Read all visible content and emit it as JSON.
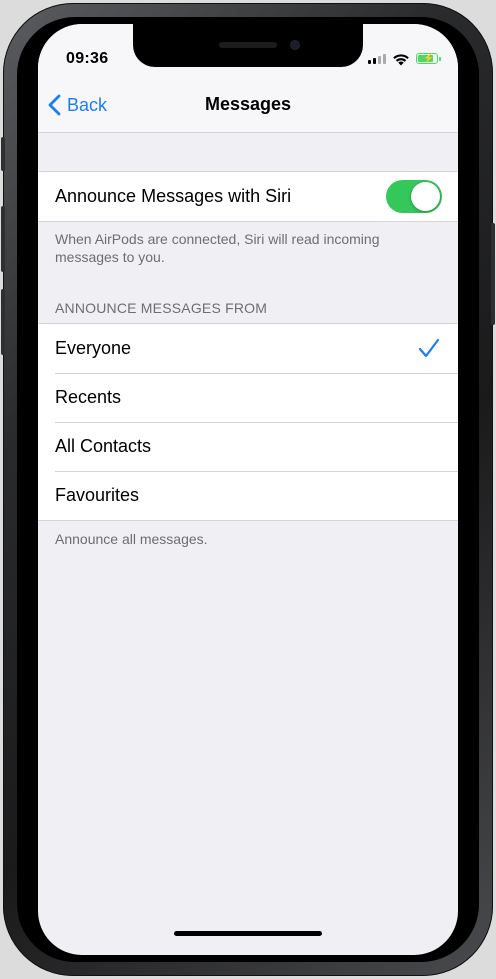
{
  "status_bar": {
    "time": "09:36",
    "icons": [
      "signal-icon",
      "wifi-icon",
      "battery-charging-icon"
    ]
  },
  "nav": {
    "back_label": "Back",
    "title": "Messages"
  },
  "siri_section": {
    "toggle_label": "Announce Messages with Siri",
    "toggle_on": true,
    "footer": "When AirPods are connected, Siri will read incoming messages to you."
  },
  "announce_section": {
    "header": "ANNOUNCE MESSAGES FROM",
    "options": [
      {
        "label": "Everyone",
        "selected": true
      },
      {
        "label": "Recents",
        "selected": false
      },
      {
        "label": "All Contacts",
        "selected": false
      },
      {
        "label": "Favourites",
        "selected": false
      }
    ],
    "footer": "Announce all messages."
  },
  "colors": {
    "accent": "#1a7ef5",
    "toggle_on": "#34c759",
    "background": "#efeff4"
  }
}
